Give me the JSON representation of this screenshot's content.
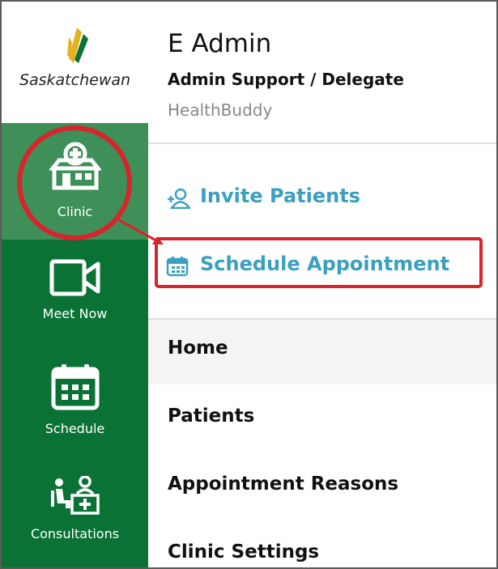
{
  "sidebar": {
    "logo_text": "Saskatchewan",
    "items": [
      {
        "label": "Clinic",
        "icon": "clinic-icon",
        "active": true
      },
      {
        "label": "Meet Now",
        "icon": "video-camera-icon"
      },
      {
        "label": "Schedule",
        "icon": "calendar-icon"
      },
      {
        "label": "Consultations",
        "icon": "consultations-icon"
      }
    ]
  },
  "header": {
    "user_name": "E Admin",
    "role": "Admin Support / Delegate",
    "app_name": "HealthBuddy"
  },
  "actions": {
    "invite_label": "Invite Patients",
    "schedule_label": "Schedule Appointment"
  },
  "menu": [
    {
      "label": "Home"
    },
    {
      "label": "Patients"
    },
    {
      "label": "Appointment Reasons"
    },
    {
      "label": "Clinic Settings"
    }
  ],
  "colors": {
    "sidebar_bg": "#0b7236",
    "sidebar_active": "#3e8f58",
    "accent": "#3aa0c2",
    "annotation": "#d8242c"
  }
}
